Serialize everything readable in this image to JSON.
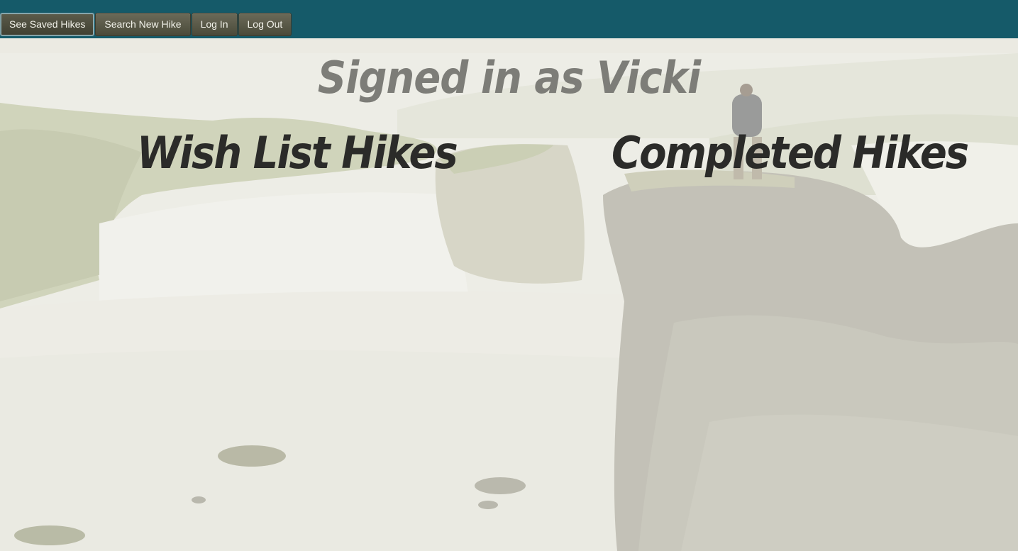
{
  "nav": {
    "saved_label": "See Saved Hikes",
    "search_label": "Search New Hike",
    "login_label": "Log In",
    "logout_label": "Log Out"
  },
  "status": {
    "signed_in_text": "Signed in as Vicki"
  },
  "sections": {
    "wish_list_title": "Wish List Hikes",
    "completed_title": "Completed Hikes"
  },
  "colors": {
    "topbar": "#155a69",
    "button": "#5a5a48",
    "heading": "#2b2b29",
    "signed_in": "#7d7d78"
  },
  "background": {
    "icon": "waterfall-photo"
  }
}
